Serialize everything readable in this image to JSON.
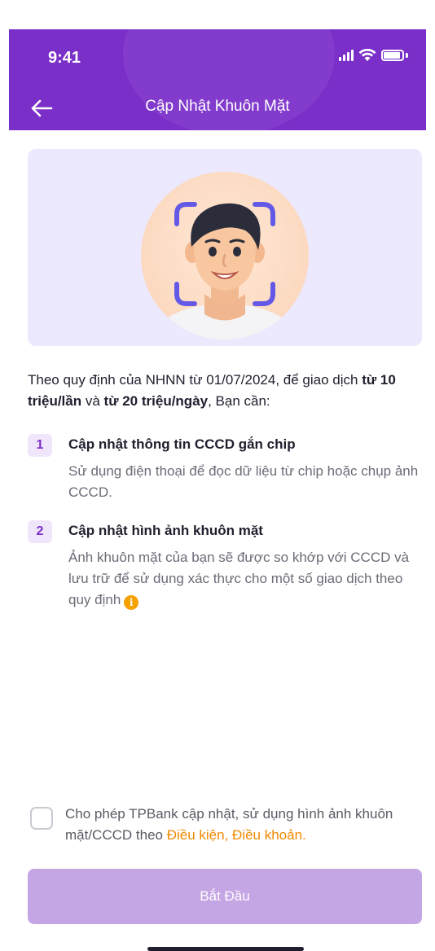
{
  "status_bar": {
    "time": "9:41"
  },
  "nav": {
    "title": "Cập Nhật Khuôn Mặt"
  },
  "intro": {
    "part1": "Theo quy định của NHNN từ 01/07/2024, để giao dịch ",
    "bold1": "từ 10 triệu/lần",
    "part2": " và ",
    "bold2": "từ 20 triệu/ngày",
    "part3": ", Bạn cần:"
  },
  "steps": [
    {
      "number": "1",
      "title": "Cập nhật thông tin CCCD gắn chip",
      "description": "Sử dụng điện thoại để đọc dữ liệu từ chip hoặc chụp ảnh CCCD."
    },
    {
      "number": "2",
      "title": "Cập nhật hình ảnh khuôn mặt",
      "description": "Ảnh khuôn mặt của bạn sẽ được so khớp với CCCD và lưu trữ để sử dụng xác thực cho một số giao dịch theo quy định"
    }
  ],
  "info_icon_glyph": "i",
  "consent": {
    "text": "Cho phép TPBank cập nhật, sử dụng hình ảnh khuôn mặt/CCCD theo ",
    "link": "Điều kiện, Điều khoản.",
    "checked": false
  },
  "start_button": {
    "label": "Bắt Đầu",
    "enabled": false
  },
  "colors": {
    "header": "#7b2fc9",
    "hero_bg": "#ece8fd",
    "button_disabled": "#c5a6e4",
    "link": "#f08a00",
    "step_badge_bg": "#efe6fc"
  },
  "icons": [
    "back-arrow-icon",
    "signal-icon",
    "wifi-icon",
    "battery-icon",
    "info-icon",
    "face-scan-frame-icon"
  ]
}
